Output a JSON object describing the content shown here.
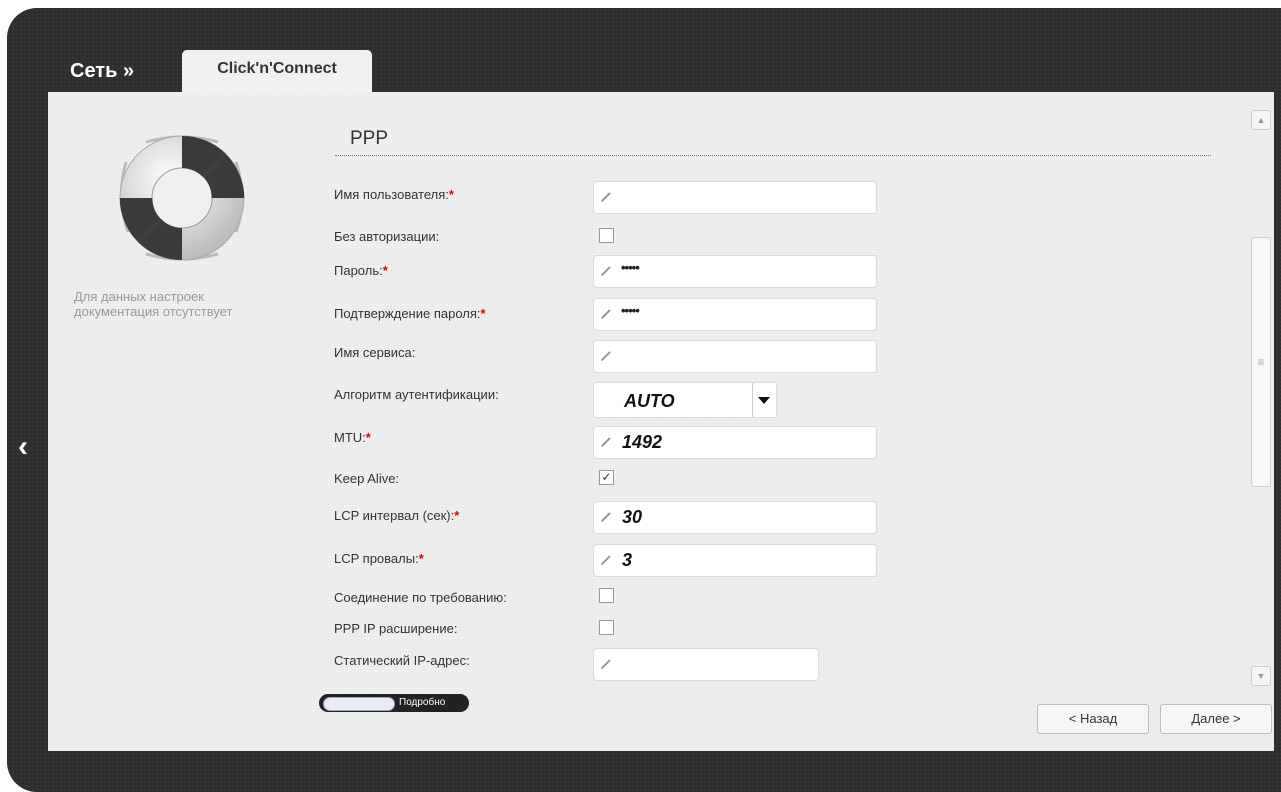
{
  "header": {
    "breadcrumb": "Сеть »",
    "tab": "Click'n'Connect"
  },
  "sidebar": {
    "help_text_line1": "Для данных настроек",
    "help_text_line2": "документация отсутствует",
    "back_icon": "chevron-left-icon",
    "help_icon": "lifebuoy-icon"
  },
  "section": {
    "title": "PPP"
  },
  "form": {
    "username_label": "Имя пользователя:",
    "username_value": "",
    "no_auth_label": "Без авторизации:",
    "no_auth_checked": false,
    "password_label": "Пароль:",
    "password_value": "•••••",
    "password_confirm_label": "Подтверждение пароля:",
    "password_confirm_value": "•••••",
    "service_name_label": "Имя сервиса:",
    "service_name_value": "",
    "auth_algo_label": "Алгоритм аутентификации:",
    "auth_algo_value": "AUTO",
    "mtu_label": "MTU:",
    "mtu_value": "1492",
    "keep_alive_label": "Keep Alive:",
    "keep_alive_checked": true,
    "lcp_interval_label": "LCP интервал (сек):",
    "lcp_interval_value": "30",
    "lcp_fails_label": "LCP провалы:",
    "lcp_fails_value": "3",
    "on_demand_label": "Соединение по требованию:",
    "on_demand_checked": false,
    "ppp_ip_ext_label": "PPP IP расширение:",
    "ppp_ip_ext_checked": false,
    "static_ip_label": "Статический IP-адрес:",
    "static_ip_value": "",
    "required_mark": "*"
  },
  "footer": {
    "details_toggle_label": "Подробно",
    "back_button": "< Назад",
    "next_button": "Далее >"
  },
  "colors": {
    "frame": "#2e2e2e",
    "panel": "#f0f0f0",
    "required": "#e00000"
  }
}
